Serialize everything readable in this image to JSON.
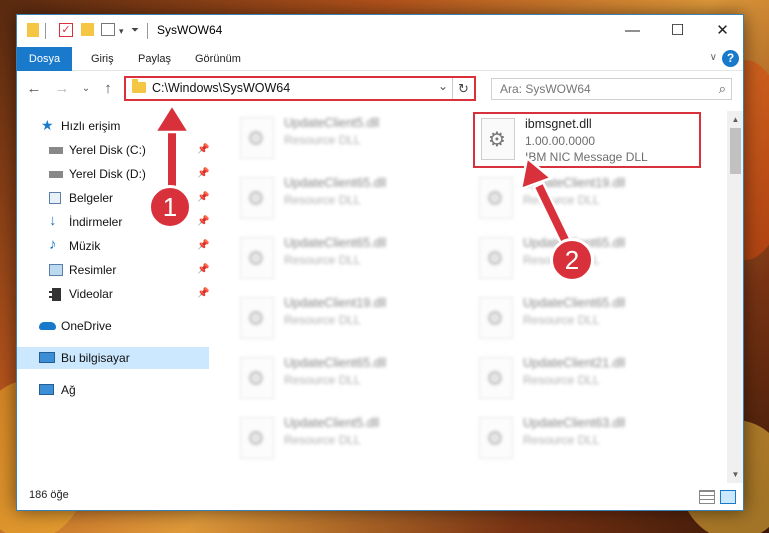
{
  "window": {
    "title": "SysWOW64",
    "controls": {
      "minimize": "—",
      "maximize": "☐",
      "close": "✕"
    }
  },
  "ribbon": {
    "tabs": [
      "Dosya",
      "Giriş",
      "Paylaş",
      "Görünüm"
    ],
    "help": "?"
  },
  "nav": {
    "address": "C:\\Windows\\SysWOW64",
    "search_placeholder": "Ara: SysWOW64"
  },
  "sidebar": {
    "items": [
      {
        "label": "Hızlı erişim",
        "icon": "star-icon"
      },
      {
        "label": "Yerel Disk (C:)",
        "icon": "drive-icon",
        "pinned": true
      },
      {
        "label": "Yerel Disk (D:)",
        "icon": "drive-icon",
        "pinned": true
      },
      {
        "label": "Belgeler",
        "icon": "documents-icon",
        "pinned": true
      },
      {
        "label": "İndirmeler",
        "icon": "download-icon",
        "pinned": true
      },
      {
        "label": "Müzik",
        "icon": "music-icon",
        "pinned": true
      },
      {
        "label": "Resimler",
        "icon": "pictures-icon",
        "pinned": true
      },
      {
        "label": "Videolar",
        "icon": "videos-icon",
        "pinned": true
      },
      {
        "label": "OneDrive",
        "icon": "cloud-icon"
      },
      {
        "label": "Bu bilgisayar",
        "icon": "computer-icon",
        "selected": true
      },
      {
        "label": "Ağ",
        "icon": "network-icon"
      }
    ]
  },
  "files": {
    "highlighted": {
      "name": "ibmsgnet.dll",
      "version": "1.00.00.0000",
      "description": "IBM NIC Message DLL"
    },
    "left_column": [
      {
        "name": "UpdateClient5.dll",
        "type": "Resource DLL"
      },
      {
        "name": "UpdateClient65.dll",
        "type": "Resource DLL"
      },
      {
        "name": "UpdateClient65.dll",
        "type": "Resource DLL"
      },
      {
        "name": "UpdateClient19.dll",
        "type": "Resource DLL"
      },
      {
        "name": "UpdateClient65.dll",
        "type": "Resource DLL"
      },
      {
        "name": "UpdateClient5.dll",
        "type": "Resource DLL"
      }
    ],
    "right_column": [
      {
        "name": "UpdateClient19.dll",
        "type": "Resource DLL"
      },
      {
        "name": "UpdateClient65.dll",
        "type": "Resource DLL"
      },
      {
        "name": "UpdateClient65.dll",
        "type": "Resource DLL"
      },
      {
        "name": "UpdateClient21.dll",
        "type": "Resource DLL"
      },
      {
        "name": "UpdateClient63.dll",
        "type": "Resource DLL"
      }
    ]
  },
  "status": {
    "count": "186 öğe"
  },
  "callouts": {
    "step1": "1",
    "step2": "2"
  },
  "colors": {
    "accent": "#1979ca",
    "highlight": "#d9313b",
    "selected": "#cce8ff"
  }
}
